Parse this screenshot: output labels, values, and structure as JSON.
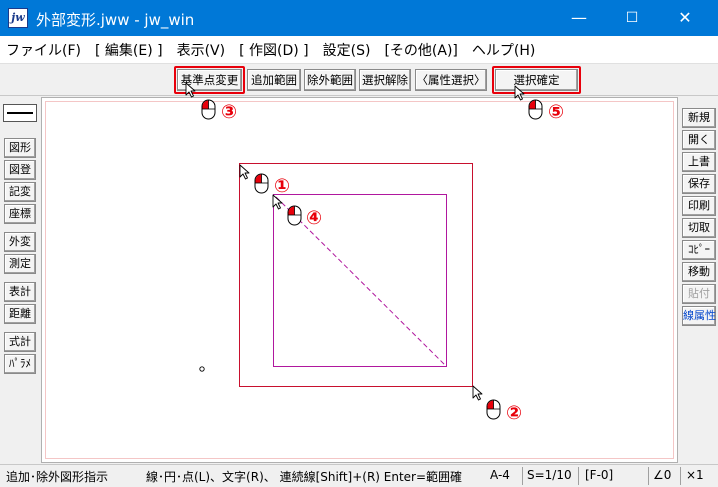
{
  "window": {
    "icon_label": "jw",
    "title": "外部変形.jww - jw_win",
    "minimize": "—",
    "maximize": "☐",
    "close": "✕"
  },
  "menu": [
    "ファイル(F)",
    "[ 編集(E) ]",
    "表示(V)",
    "[ 作図(D) ]",
    "設定(S)",
    "[その他(A)]",
    "ヘルプ(H)"
  ],
  "toolbar": {
    "base_point_change": "基準点変更",
    "add_range": "追加範囲",
    "exclude_range": "除外範囲",
    "deselect": "選択解除",
    "attr_select": "〈属性選択〉",
    "confirm_selection": "選択確定"
  },
  "left_panel": [
    "図形",
    "図登",
    "記変",
    "座標",
    "外変",
    "測定",
    "表計",
    "距離",
    "式計",
    "ﾊﾟﾗﾒ"
  ],
  "right_panel": [
    "新規",
    "開く",
    "上書",
    "保存",
    "印刷",
    "切取",
    "ｺﾋﾟｰ",
    "移動",
    "貼付",
    "線属性"
  ],
  "annotations": [
    "①",
    "②",
    "③",
    "④",
    "⑤"
  ],
  "colors": {
    "accent": "#e8000b",
    "outer_rect": "#c8102e",
    "inner_rect": "#b0179e",
    "titlebar": "#0078d7"
  },
  "status": {
    "instruction": "追加･除外図形指示",
    "hint": "線･円･点(L)、文字(R)、 連続線[Shift]+(R)  Enter=範囲確",
    "paper": "A-4",
    "scale": "S=1/10",
    "layer": "[F-0]",
    "angle": "∠0",
    "zoom": "×1"
  }
}
